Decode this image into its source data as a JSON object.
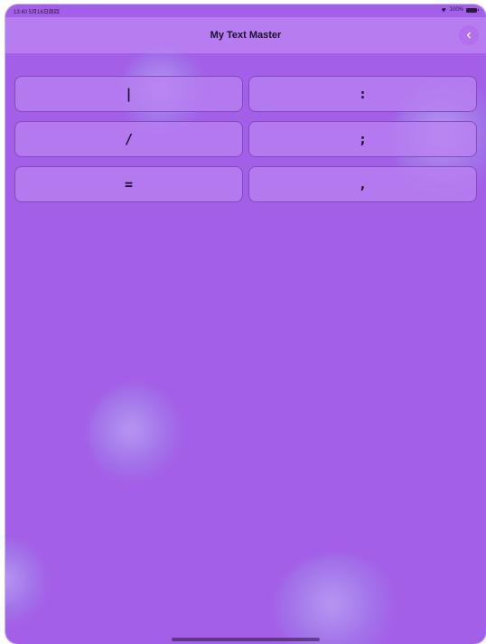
{
  "status_bar": {
    "time": "13:40  5月16日周四",
    "battery": "100%",
    "icons": [
      "wifi-icon",
      "battery-icon"
    ]
  },
  "header": {
    "title": "My Text Master",
    "back_icon": "chevron-left-icon"
  },
  "keys": [
    {
      "label": "|"
    },
    {
      "label": ":"
    },
    {
      "label": "/"
    },
    {
      "label": ";"
    },
    {
      "label": "="
    },
    {
      "label": ","
    }
  ],
  "colors": {
    "background": "#a45fe8",
    "nav_bar": "#c696f5",
    "button_fill": "#b982f2",
    "back_button": "#b46ef0",
    "text": "#1c1030"
  }
}
